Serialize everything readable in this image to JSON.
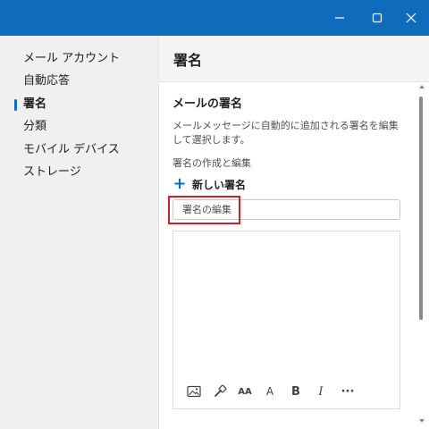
{
  "titlebar": {
    "color": "#0f6cbd",
    "icons": [
      "minimize-icon",
      "maximize-icon",
      "close-icon"
    ]
  },
  "sidebar": {
    "items": [
      {
        "label": "メール アカウント",
        "active": false
      },
      {
        "label": "自動応答",
        "active": false
      },
      {
        "label": "署名",
        "active": true
      },
      {
        "label": "分類",
        "active": false
      },
      {
        "label": "モバイル デバイス",
        "active": false
      },
      {
        "label": "ストレージ",
        "active": false
      }
    ]
  },
  "header": {
    "title": "署名"
  },
  "main": {
    "section_title": "メールの署名",
    "description": "メールメッセージに自動的に追加される署名を編集して選択します。",
    "sub_label": "署名の作成と編集",
    "new_signature": {
      "icon": "plus-icon",
      "label": "新しい署名"
    },
    "name_input": {
      "placeholder": "署名の編集",
      "value": ""
    },
    "highlight_color": "#d21f26",
    "toolbar": {
      "icons": [
        "insert-image-icon",
        "format-painter-icon",
        "font-size-icon",
        "superscript-icon",
        "bold-icon",
        "italic-icon",
        "more-icon"
      ],
      "font_size_glyph": "AA",
      "superscript_glyph": "A",
      "bold_glyph": "B",
      "italic_glyph": "I",
      "more_glyph": "···"
    }
  },
  "colors": {
    "accent": "#0f6cbd",
    "sidebar_bg": "#f0f0f0",
    "header_bg": "#f5f5f5"
  }
}
